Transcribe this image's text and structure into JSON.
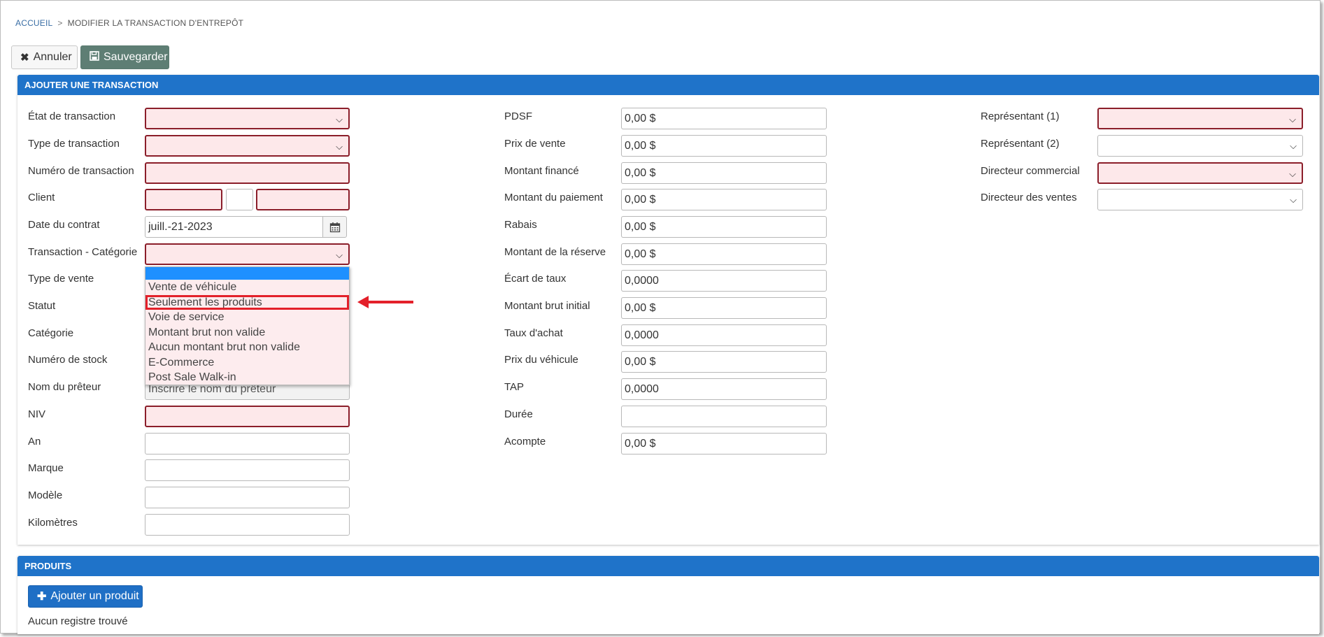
{
  "breadcrumb": {
    "home": "ACCUEIL",
    "separator": ">",
    "current": "MODIFIER LA TRANSACTION D'ENTREPÔT"
  },
  "toolbar": {
    "cancel_label": "Annuler",
    "save_label": "Sauvegarder",
    "cancel_icon": "close-icon",
    "save_icon": "floppy-disk-icon"
  },
  "transaction_panel": {
    "title": "AJOUTER UNE TRANSACTION"
  },
  "left_column": {
    "etat": {
      "label": "État de transaction",
      "value": ""
    },
    "type": {
      "label": "Type de transaction",
      "value": ""
    },
    "numero": {
      "label": "Numéro de transaction",
      "value": ""
    },
    "client": {
      "label": "Client",
      "first": "",
      "middle": "",
      "last": ""
    },
    "date": {
      "label": "Date du contrat",
      "value": "juill.-21-2023"
    },
    "categorie_tx": {
      "label": "Transaction - Catégorie",
      "value": ""
    },
    "type_vente": {
      "label": "Type de vente"
    },
    "statut": {
      "label": "Statut"
    },
    "categorie": {
      "label": "Catégorie"
    },
    "numero_stock": {
      "label": "Numéro de stock"
    },
    "preteur": {
      "label": "Nom du prêteur",
      "placeholder": "Inscrire le nom du prêteur"
    },
    "niv": {
      "label": "NIV",
      "value": ""
    },
    "an": {
      "label": "An",
      "value": ""
    },
    "marque": {
      "label": "Marque",
      "value": ""
    },
    "modele": {
      "label": "Modèle",
      "value": ""
    },
    "km": {
      "label": "Kilomètres",
      "value": ""
    }
  },
  "dropdown": {
    "options": [
      "Vente de véhicule",
      "Seulement les produits",
      "Voie de service",
      "Montant brut non valide",
      "Aucun montant brut non valide",
      "E-Commerce",
      "Post Sale Walk-in"
    ],
    "highlighted_option": "Seulement les produits"
  },
  "middle_column": {
    "pdsf": {
      "label": "PDSF",
      "value": "0,00 $"
    },
    "prix_vente": {
      "label": "Prix de vente",
      "value": "0,00 $"
    },
    "montant_finance": {
      "label": "Montant financé",
      "value": "0,00 $"
    },
    "montant_paiement": {
      "label": "Montant du paiement",
      "value": "0,00 $"
    },
    "rabais": {
      "label": "Rabais",
      "value": "0,00 $"
    },
    "reserve": {
      "label": "Montant de la réserve",
      "value": "0,00 $"
    },
    "ecart": {
      "label": "Écart de taux",
      "value": "0,0000"
    },
    "brut_initial": {
      "label": "Montant brut initial",
      "value": "0,00 $"
    },
    "taux_achat": {
      "label": "Taux d'achat",
      "value": "0,0000"
    },
    "prix_vehicule": {
      "label": "Prix du véhicule",
      "value": "0,00 $"
    },
    "tap": {
      "label": "TAP",
      "value": "0,0000"
    },
    "duree": {
      "label": "Durée",
      "value": ""
    },
    "acompte": {
      "label": "Acompte",
      "value": "0,00 $"
    }
  },
  "right_column": {
    "rep1": {
      "label": "Représentant (1)",
      "value": ""
    },
    "rep2": {
      "label": "Représentant (2)",
      "value": ""
    },
    "dir_commercial": {
      "label": "Directeur commercial",
      "value": ""
    },
    "dir_ventes": {
      "label": "Directeur des ventes",
      "value": ""
    }
  },
  "products_panel": {
    "title": "PRODUITS",
    "add_label": "Ajouter un produit",
    "empty_text": "Aucun registre trouvé"
  },
  "colors": {
    "header_blue": "#1f73c9",
    "required_bg": "#fde8ea",
    "required_border": "#8b1e2a",
    "save_green": "#5e7e74",
    "annotation_red": "#e3202a",
    "selected_option_blue": "#1e90ff"
  }
}
